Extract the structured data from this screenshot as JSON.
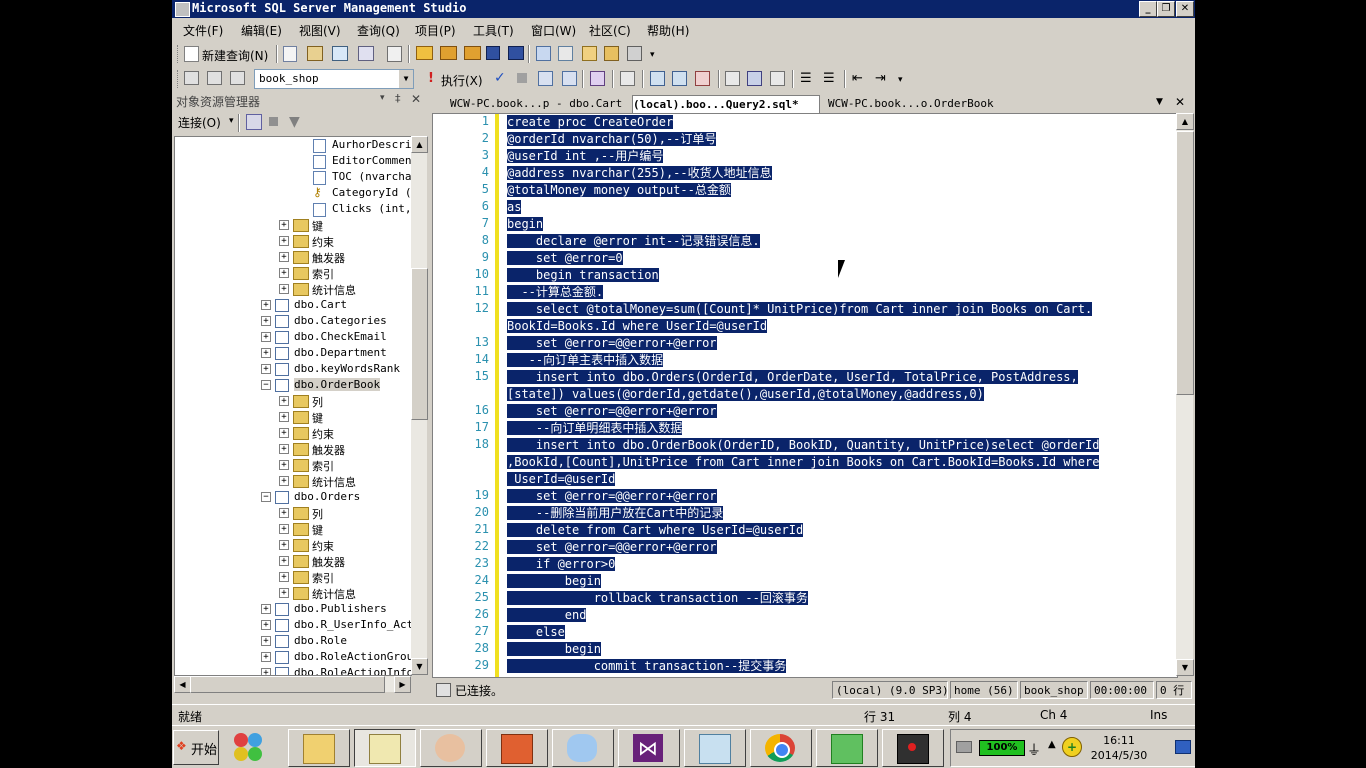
{
  "window": {
    "title": "Microsoft SQL Server Management Studio",
    "minimize": "_",
    "restore": "❐",
    "close": "✕"
  },
  "menu": [
    "文件(F)",
    "编辑(E)",
    "视图(V)",
    "查询(Q)",
    "项目(P)",
    "工具(T)",
    "窗口(W)",
    "社区(C)",
    "帮助(H)"
  ],
  "toolbar": {
    "new_query": "新建查询(N)",
    "database": "book_shop",
    "execute": "执行(X)"
  },
  "object_explorer": {
    "title": "对象资源管理器",
    "connect": "连接(O)",
    "tree": [
      {
        "label": "AurhorDescrip",
        "kind": "column",
        "indent": 3
      },
      {
        "label": "EditorComment",
        "kind": "column",
        "indent": 3
      },
      {
        "label": "TOC (nvarchar",
        "kind": "column",
        "indent": 3
      },
      {
        "label": "CategoryId (F",
        "kind": "key",
        "indent": 3
      },
      {
        "label": "Clicks (int,",
        "kind": "column",
        "indent": 3
      },
      {
        "label": "键",
        "kind": "folder",
        "indent": 2
      },
      {
        "label": "约束",
        "kind": "folder",
        "indent": 2
      },
      {
        "label": "触发器",
        "kind": "folder",
        "indent": 2
      },
      {
        "label": "索引",
        "kind": "folder",
        "indent": 2
      },
      {
        "label": "统计信息",
        "kind": "folder",
        "indent": 2
      },
      {
        "label": "dbo.Cart",
        "kind": "table",
        "indent": 1
      },
      {
        "label": "dbo.Categories",
        "kind": "table",
        "indent": 1
      },
      {
        "label": "dbo.CheckEmail",
        "kind": "table",
        "indent": 1
      },
      {
        "label": "dbo.Department",
        "kind": "table",
        "indent": 1
      },
      {
        "label": "dbo.keyWordsRank",
        "kind": "table",
        "indent": 1
      },
      {
        "label": "dbo.OrderBook",
        "kind": "table-open",
        "indent": 1,
        "selected": true
      },
      {
        "label": "列",
        "kind": "folder",
        "indent": 2
      },
      {
        "label": "键",
        "kind": "folder",
        "indent": 2
      },
      {
        "label": "约束",
        "kind": "folder",
        "indent": 2
      },
      {
        "label": "触发器",
        "kind": "folder",
        "indent": 2
      },
      {
        "label": "索引",
        "kind": "folder",
        "indent": 2
      },
      {
        "label": "统计信息",
        "kind": "folder",
        "indent": 2
      },
      {
        "label": "dbo.Orders",
        "kind": "table-open",
        "indent": 1
      },
      {
        "label": "列",
        "kind": "folder",
        "indent": 2
      },
      {
        "label": "键",
        "kind": "folder",
        "indent": 2
      },
      {
        "label": "约束",
        "kind": "folder",
        "indent": 2
      },
      {
        "label": "触发器",
        "kind": "folder",
        "indent": 2
      },
      {
        "label": "索引",
        "kind": "folder",
        "indent": 2
      },
      {
        "label": "统计信息",
        "kind": "folder",
        "indent": 2
      },
      {
        "label": "dbo.Publishers",
        "kind": "table",
        "indent": 1
      },
      {
        "label": "dbo.R_UserInfo_Acti",
        "kind": "table",
        "indent": 1
      },
      {
        "label": "dbo.Role",
        "kind": "table",
        "indent": 1
      },
      {
        "label": "dbo.RoleActionGroup",
        "kind": "table",
        "indent": 1
      },
      {
        "label": "dbo.RoleActionInfo",
        "kind": "table",
        "indent": 1
      }
    ]
  },
  "tabs": [
    {
      "label": "WCW-PC.book...p - dbo.Cart",
      "active": false
    },
    {
      "label": "(local).boo...Query2.sql*",
      "active": true
    },
    {
      "label": "WCW-PC.book...o.OrderBook",
      "active": false
    }
  ],
  "editor": {
    "lines": [
      {
        "n": "1",
        "text": "create proc CreateOrder"
      },
      {
        "n": "2",
        "text": "@orderId nvarchar(50),--订单号"
      },
      {
        "n": "3",
        "text": "@userId int ,--用户编号"
      },
      {
        "n": "4",
        "text": "@address nvarchar(255),--收货人地址信息"
      },
      {
        "n": "5",
        "text": "@totalMoney money output--总金额"
      },
      {
        "n": "6",
        "text": "as"
      },
      {
        "n": "7",
        "text": "begin"
      },
      {
        "n": "8",
        "text": "    declare @error int--记录错误信息."
      },
      {
        "n": "9",
        "text": "    set @error=0"
      },
      {
        "n": "10",
        "text": "    begin transaction"
      },
      {
        "n": "11",
        "text": "  --计算总金额."
      },
      {
        "n": "12",
        "text": "    select @totalMoney=sum([Count]* UnitPrice)from Cart inner join Books on Cart."
      },
      {
        "n": "",
        "text": "BookId=Books.Id where UserId=@userId"
      },
      {
        "n": "13",
        "text": "    set @error=@@error+@error"
      },
      {
        "n": "14",
        "text": "   --向订单主表中插入数据"
      },
      {
        "n": "15",
        "text": "    insert into dbo.Orders(OrderId, OrderDate, UserId, TotalPrice, PostAddress,"
      },
      {
        "n": "",
        "text": "[state]) values(@orderId,getdate(),@userId,@totalMoney,@address,0)"
      },
      {
        "n": "16",
        "text": "    set @error=@@error+@error"
      },
      {
        "n": "17",
        "text": "    --向订单明细表中插入数据"
      },
      {
        "n": "18",
        "text": "    insert into dbo.OrderBook(OrderID, BookID, Quantity, UnitPrice)select @orderId"
      },
      {
        "n": "",
        "text": ",BookId,[Count],UnitPrice from Cart inner join Books on Cart.BookId=Books.Id where"
      },
      {
        "n": "",
        "text": " UserId=@userId"
      },
      {
        "n": "19",
        "text": "    set @error=@@error+@error"
      },
      {
        "n": "20",
        "text": "    --删除当前用户放在Cart中的记录"
      },
      {
        "n": "21",
        "text": "    delete from Cart where UserId=@userId"
      },
      {
        "n": "22",
        "text": "    set @error=@@error+@error"
      },
      {
        "n": "23",
        "text": "    if @error>0"
      },
      {
        "n": "24",
        "text": "        begin"
      },
      {
        "n": "25",
        "text": "            rollback transaction --回滚事务"
      },
      {
        "n": "26",
        "text": "        end"
      },
      {
        "n": "27",
        "text": "    else"
      },
      {
        "n": "28",
        "text": "        begin"
      },
      {
        "n": "29",
        "text": "            commit transaction--提交事务"
      }
    ]
  },
  "query_status": {
    "connected": "已连接。",
    "server": "(local) (9.0 SP3)",
    "user": "home (56)",
    "database": "book_shop",
    "time": "00:00:00",
    "rows": "0 行"
  },
  "status_bar": {
    "ready": "就绪",
    "line": "行 31",
    "col": "列 4",
    "ch": "Ch 4",
    "ins": "Ins"
  },
  "taskbar": {
    "start": "开始",
    "battery": "100%",
    "time": "16:11",
    "date": "2014/5/30"
  }
}
